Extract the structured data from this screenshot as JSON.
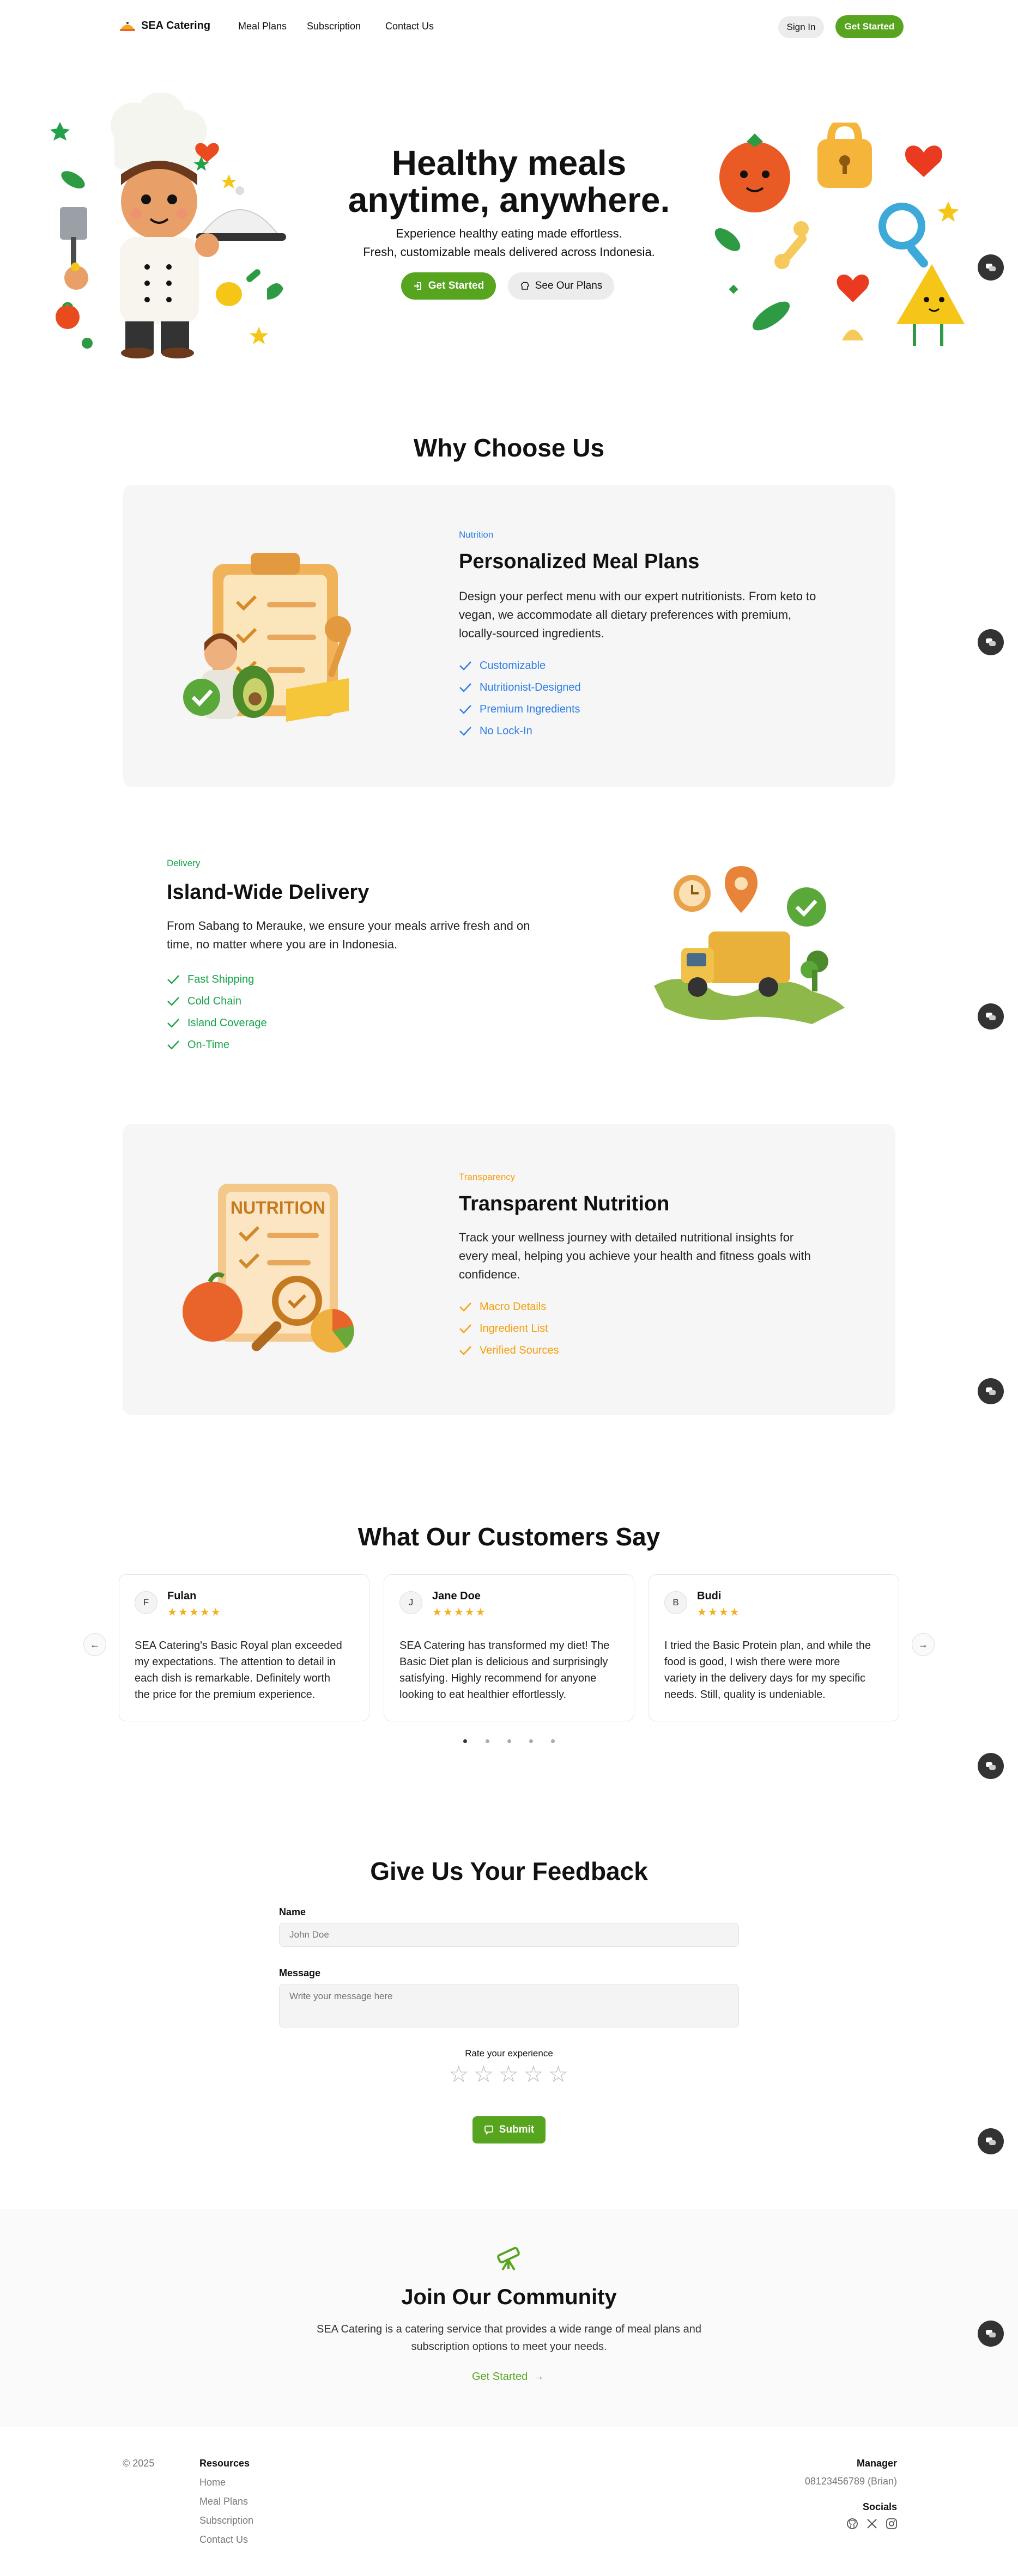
{
  "nav": {
    "brand": "SEA Catering",
    "links": [
      "Meal Plans",
      "Subscription",
      "Contact Us"
    ],
    "sign_in": "Sign In",
    "get_started": "Get Started"
  },
  "hero": {
    "title_line1": "Healthy meals",
    "title_line2": "anytime, anywhere.",
    "subtitle_line1": "Experience healthy eating made effortless.",
    "subtitle_line2": "Fresh, customizable meals delivered across Indonesia.",
    "primary_button": "Get Started",
    "secondary_button": "See Our Plans"
  },
  "why": {
    "title": "Why Choose Us",
    "features": [
      {
        "tag": "Nutrition",
        "title": "Personalized Meal Plans",
        "desc_lines": [
          "Design your perfect menu with our expert nutritionists. From keto to",
          "vegan, we accommodate all dietary preferences with premium,",
          "locally-sourced ingredients."
        ],
        "items": [
          "Customizable",
          "Nutritionist-Designed",
          "Premium Ingredients",
          "No Lock-In"
        ],
        "color": "#2b7de9"
      },
      {
        "tag": "Delivery",
        "title": "Island-Wide Delivery",
        "desc_lines": [
          "From Sabang to Merauke, we ensure your meals arrive fresh and on",
          "time, no matter where you are in Indonesia."
        ],
        "items": [
          "Fast Shipping",
          "Cold Chain",
          "Island Coverage",
          "On-Time"
        ],
        "color": "#16a34a"
      },
      {
        "tag": "Transparency",
        "title": "Transparent Nutrition",
        "desc_lines": [
          "Track your wellness journey with detailed nutritional insights for",
          "every meal, helping you achieve your health and fitness goals with",
          "confidence."
        ],
        "items": [
          "Macro Details",
          "Ingredient List",
          "Verified Sources"
        ],
        "color": "#f59e0b"
      }
    ],
    "illustration_labels": {
      "nutrition_doc": "NUTRITION"
    }
  },
  "testimonials": {
    "title": "What Our Customers Say",
    "items": [
      {
        "initial": "F",
        "name": "Fulan",
        "stars": "★★★★★",
        "quote_lines": [
          "SEA Catering's Basic Royal plan exceeded",
          "my expectations. The attention to detail in",
          "each dish is remarkable. Definitely worth",
          "the price for the premium experience."
        ]
      },
      {
        "initial": "J",
        "name": "Jane Doe",
        "stars": "★★★★★",
        "quote_lines": [
          "SEA Catering has transformed my diet! The",
          "Basic Diet plan is delicious and surprisingly",
          "satisfying. Highly recommend for anyone",
          "looking to eat healthier effortlessly."
        ]
      },
      {
        "initial": "B",
        "name": "Budi",
        "stars": "★★★★",
        "quote_lines": [
          "I tried the Basic Protein plan, and while the",
          "food is good, I wish there were more",
          "variety in the delivery days for my specific",
          "needs. Still, quality is undeniable."
        ]
      }
    ],
    "prev_icon": "←",
    "next_icon": "→",
    "active_dot": 0,
    "dot_count": 5
  },
  "feedback": {
    "title": "Give Us Your Feedback",
    "name_label": "Name",
    "name_placeholder": "John Doe",
    "message_label": "Message",
    "message_placeholder": "Write your message here",
    "rate_label": "Rate your experience",
    "rating": 0,
    "submit": "Submit"
  },
  "community": {
    "title": "Join Our Community",
    "desc_line1": "SEA Catering is a catering service that provides a wide range of meal plans and",
    "desc_line2": "subscription options to meet your needs.",
    "cta": "Get Started"
  },
  "footer": {
    "copyright": "© 2025",
    "resources_title": "Resources",
    "resources": [
      "Home",
      "Meal Plans",
      "Subscription",
      "Contact Us"
    ],
    "manager_title": "Manager",
    "manager_contact": "08123456789 (Brian)",
    "socials_title": "Socials",
    "social_icons": [
      "github-icon",
      "x-icon",
      "instagram-icon"
    ]
  },
  "colors": {
    "brand_green": "#57a41f",
    "blue": "#2b7de9",
    "green": "#16a34a",
    "orange": "#f59e0b"
  }
}
